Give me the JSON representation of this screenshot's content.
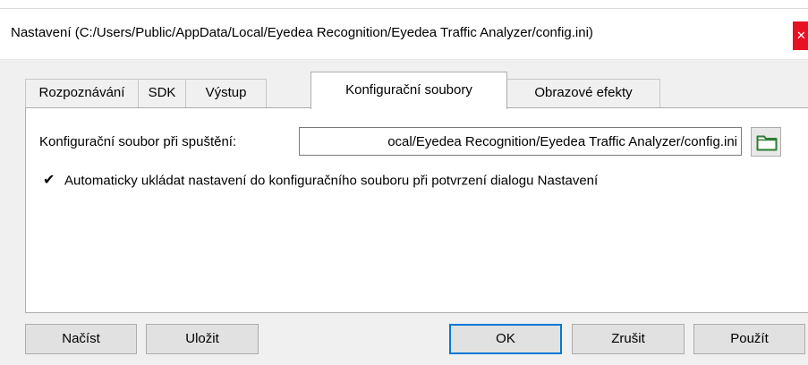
{
  "window": {
    "title": "Nastavení (C:/Users/Public/AppData/Local/Eyedea Recognition/Eyedea Traffic Analyzer/config.ini)",
    "close_glyph": "✕"
  },
  "tabs": [
    {
      "label": "Rozpoznávání",
      "active": false
    },
    {
      "label": "SDK",
      "active": false
    },
    {
      "label": "Výstup",
      "active": false
    },
    {
      "label": "Konfigurační soubory",
      "active": true
    },
    {
      "label": "Obrazové efekty",
      "active": false
    }
  ],
  "config": {
    "startup_label": "Konfigurační soubor při spuštění:",
    "startup_value": "ocal/Eyedea Recognition/Eyedea Traffic Analyzer/config.ini",
    "browse_icon": "folder-icon",
    "autosave_checked": true,
    "autosave_check_glyph": "✔",
    "autosave_label": "Automaticky ukládat nastavení do konfiguračního souboru při potvrzení dialogu Nastavení"
  },
  "buttons": {
    "load": "Načíst",
    "save": "Uložit",
    "ok": "OK",
    "cancel": "Zrušit",
    "apply": "Použít"
  },
  "colors": {
    "accent": "#0078d7",
    "close": "#e81123",
    "folder": "#2e7d32"
  }
}
